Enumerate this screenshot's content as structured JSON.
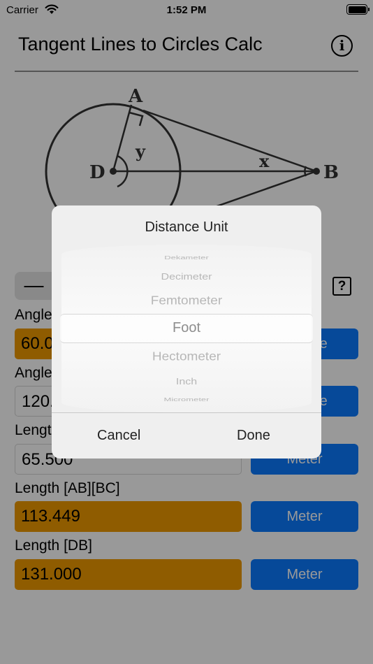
{
  "status_bar": {
    "carrier": "Carrier",
    "time": "1:52 PM"
  },
  "nav": {
    "title": "Tangent Lines to Circles Calc",
    "info_icon": "i"
  },
  "diagram": {
    "point_a": "A",
    "point_b": "B",
    "point_d": "D",
    "angle_x": "x",
    "angle_y": "y"
  },
  "controls": {
    "minus": "—",
    "help": "?"
  },
  "fields": [
    {
      "label": "Angle",
      "value": "60.0",
      "unit": "Degree"
    },
    {
      "label": "Angle",
      "value": "120.",
      "unit": "Degree"
    },
    {
      "label": "Length",
      "value": "65.500",
      "unit": "Meter"
    },
    {
      "label": "Length [AB][BC]",
      "value": "113.449",
      "unit": "Meter"
    },
    {
      "label": "Length [DB]",
      "value": "131.000",
      "unit": "Meter"
    }
  ],
  "picker_modal": {
    "title": "Distance Unit",
    "options": [
      "Dekameter",
      "Decimeter",
      "Femtometer",
      "Foot",
      "Hectometer",
      "Inch",
      "Micrometer"
    ],
    "selected": "Foot",
    "cancel_label": "Cancel",
    "done_label": "Done"
  },
  "colors": {
    "accent_blue": "#0a7aff",
    "result_orange": "#ef9a00",
    "overlay": "rgba(0,0,0,0.4)"
  }
}
